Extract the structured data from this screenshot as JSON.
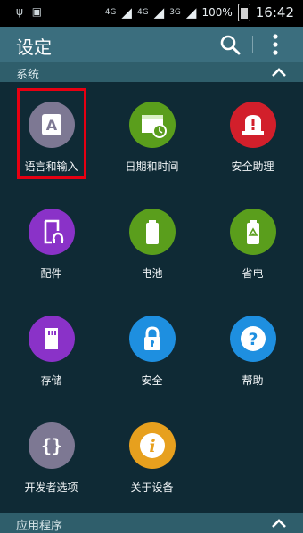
{
  "status_bar": {
    "left_icons": "usb-icon",
    "network1": "4G",
    "network2": "4G",
    "network3": "3G",
    "battery": "100%",
    "time": "16:42"
  },
  "app_bar": {
    "title": "设定"
  },
  "sections": {
    "system": {
      "label": "系统"
    },
    "apps": {
      "label": "应用程序"
    }
  },
  "tiles": {
    "language": {
      "label": "语言和输入",
      "color": "#7d7893"
    },
    "datetime": {
      "label": "日期和时间",
      "color": "#5a9e1c"
    },
    "safety": {
      "label": "安全助理",
      "color": "#d21f2b"
    },
    "accessory": {
      "label": "配件",
      "color": "#8a32c8"
    },
    "battery": {
      "label": "电池",
      "color": "#5a9e1c"
    },
    "power_saving": {
      "label": "省电",
      "color": "#5a9e1c"
    },
    "storage": {
      "label": "存储",
      "color": "#8a32c8"
    },
    "security": {
      "label": "安全",
      "color": "#1e8fe0"
    },
    "help": {
      "label": "帮助",
      "color": "#1e8fe0"
    },
    "developer": {
      "label": "开发者选项",
      "color": "#7d7893"
    },
    "about": {
      "label": "关于设备",
      "color": "#e7a01e"
    }
  }
}
